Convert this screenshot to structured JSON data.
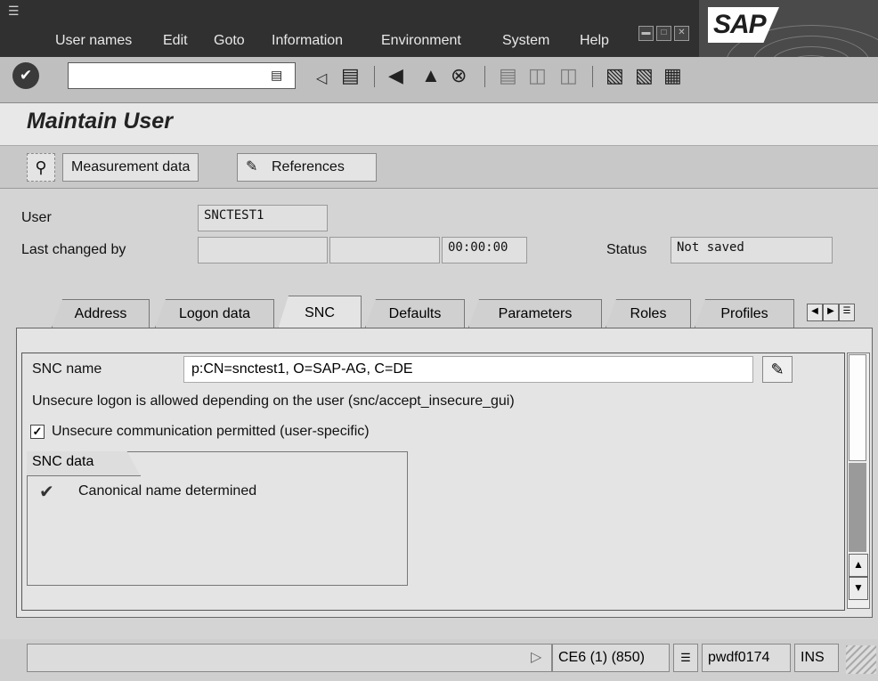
{
  "menu": {
    "items": [
      "User names",
      "Edit",
      "Goto",
      "Information",
      "Environment",
      "System",
      "Help"
    ]
  },
  "toolbar": {
    "command_value": "",
    "icons": [
      "enter-icon",
      "dropdown-icon",
      "back-icon",
      "save-icon",
      "back-nav-icon",
      "exit-icon",
      "cancel-icon",
      "print-icon",
      "find-icon",
      "find-next-icon",
      "first-page-icon",
      "last-page-icon",
      "layout-icon"
    ]
  },
  "brand": {
    "logo_text": "SAP"
  },
  "page": {
    "title": "Maintain User"
  },
  "app_toolbar": {
    "measurement_label": "Measurement data",
    "references_label": "References"
  },
  "header": {
    "user_label": "User",
    "user_value": "SNCTEST1",
    "last_changed_label": "Last changed by",
    "last_changed_value": "",
    "date_value": "",
    "time_value": "00:00:00",
    "status_label": "Status",
    "status_value": "Not saved"
  },
  "tabs": [
    {
      "label": "Address",
      "active": false
    },
    {
      "label": "Logon data",
      "active": false
    },
    {
      "label": "SNC",
      "active": true
    },
    {
      "label": "Defaults",
      "active": false
    },
    {
      "label": "Parameters",
      "active": false
    },
    {
      "label": "Roles",
      "active": false
    },
    {
      "label": "Profiles",
      "active": false
    }
  ],
  "snc": {
    "name_label": "SNC name",
    "name_value": "p:CN=snctest1, O=SAP-AG, C=DE",
    "info_text": "Unsecure logon is allowed depending on the user (snc/accept_insecure_gui)",
    "checkbox_label": "Unsecure communication permitted (user-specific)",
    "checkbox_checked": true,
    "group_title": "SNC data",
    "canonical_text": "Canonical name determined"
  },
  "status_bar": {
    "message": "",
    "system": "CE6 (1) (850)",
    "server": "pwdf0174",
    "mode": "INS"
  },
  "colors": {
    "menubar": "#303030",
    "toolbar": "#bfbfbf",
    "background": "#d4d4d4"
  }
}
